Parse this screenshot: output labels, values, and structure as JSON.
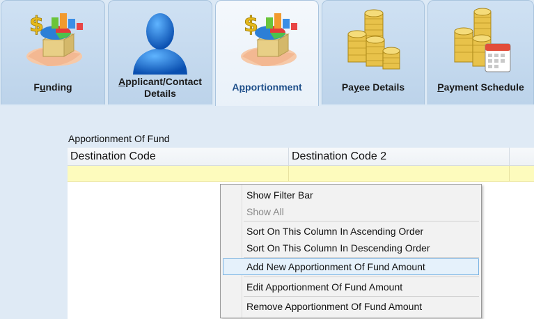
{
  "tabs": [
    {
      "label_pre": "F",
      "label_u": "u",
      "label_post": "nding",
      "line2": "",
      "icon": "grant-money-chart-icon",
      "active": false
    },
    {
      "label_pre": "",
      "label_u": "A",
      "label_post": "pplicant/Contact",
      "line2": "Details",
      "icon": "person-icon",
      "active": false
    },
    {
      "label_pre": "A",
      "label_u": "p",
      "label_post": "portionment",
      "line2": "",
      "icon": "grant-money-chart-icon",
      "active": true
    },
    {
      "label_pre": "Pa",
      "label_u": "y",
      "label_post": "ee Details",
      "line2": "",
      "icon": "gold-coins-icon",
      "active": false
    },
    {
      "label_pre": "",
      "label_u": "P",
      "label_post": "ayment Schedule",
      "line2": "",
      "icon": "coins-calendar-icon",
      "active": false
    }
  ],
  "section": {
    "label": "Apportionment Of Fund"
  },
  "grid": {
    "columns": [
      "Destination Code",
      "Destination Code 2",
      ""
    ]
  },
  "context_menu": {
    "items": [
      {
        "label": "Show Filter Bar",
        "enabled": true
      },
      {
        "label": "Show All",
        "enabled": false
      },
      {
        "label": "Sort On This Column In Ascending Order",
        "enabled": true
      },
      {
        "label": "Sort On This Column In Descending Order",
        "enabled": true
      },
      {
        "label": "Add New Apportionment Of Fund Amount",
        "enabled": true,
        "highlighted": true
      },
      {
        "label": "Edit Apportionment Of Fund Amount",
        "enabled": true
      },
      {
        "label": "Remove Apportionment Of Fund Amount",
        "enabled": true
      }
    ]
  },
  "colors": {
    "active_tab_text": "#1f4f8a",
    "filter_row": "#fdfbbd",
    "menu_highlight": "#e5f1fb",
    "menu_highlight_border": "#7bb4e3"
  }
}
